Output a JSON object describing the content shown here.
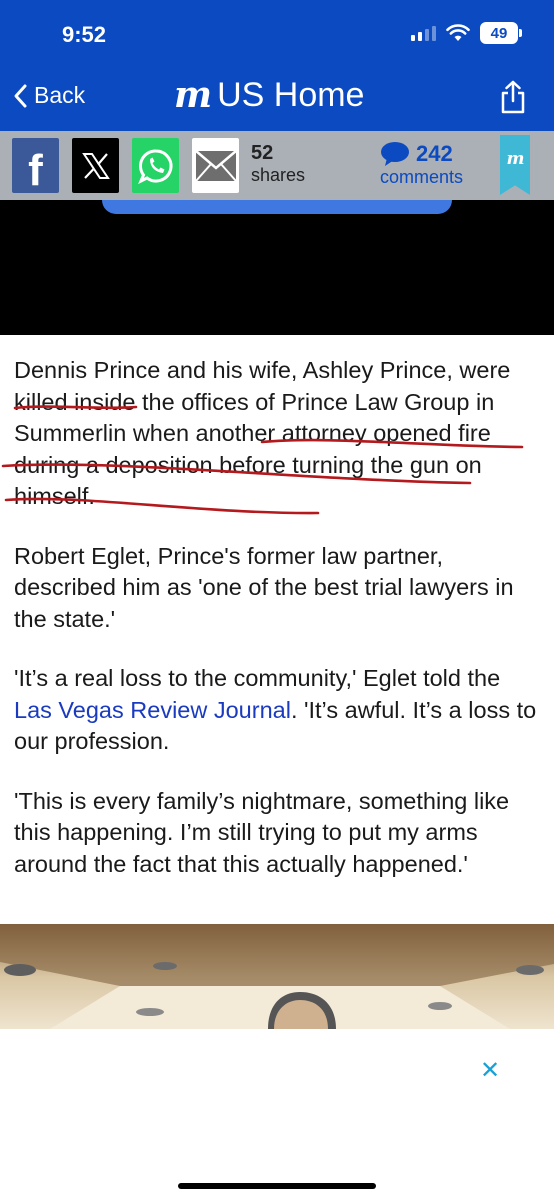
{
  "status": {
    "time": "9:52",
    "battery": "49"
  },
  "nav": {
    "back_label": "Back",
    "logo": "m",
    "title": "US Home"
  },
  "share_bar": {
    "facebook": "f",
    "shares_count": "52",
    "shares_label": "shares",
    "comments_count": "242",
    "comments_label": "comments",
    "bookmark_logo": "m"
  },
  "article": {
    "p1_part1": "Dennis Prince and his wife, Ashley Prince, were killed inside the offices of Prince Law Group in Summerlin when another attorney opened fire during a deposition before turning the gun on himself.",
    "p2": "Robert Eglet, Prince's former law partner, described him as 'one of the best trial lawyers in the state.'",
    "p3_before": "'It’s a real loss to the community,' Eglet told the ",
    "p3_link": "Las Vegas Review Journal",
    "p3_after": ". 'It’s awful. It’s a loss to our profession.",
    "p4": "'This is every family’s nightmare, something like this happening. I’m still trying to put my arms around the fact that this actually happened.'"
  },
  "ad": {
    "close_label": "✕"
  },
  "colors": {
    "nav_blue": "#0b4ac0",
    "share_bar_gray": "#aab0b6",
    "link_blue": "#1a3bbf",
    "annotation_red": "#b3191d"
  }
}
